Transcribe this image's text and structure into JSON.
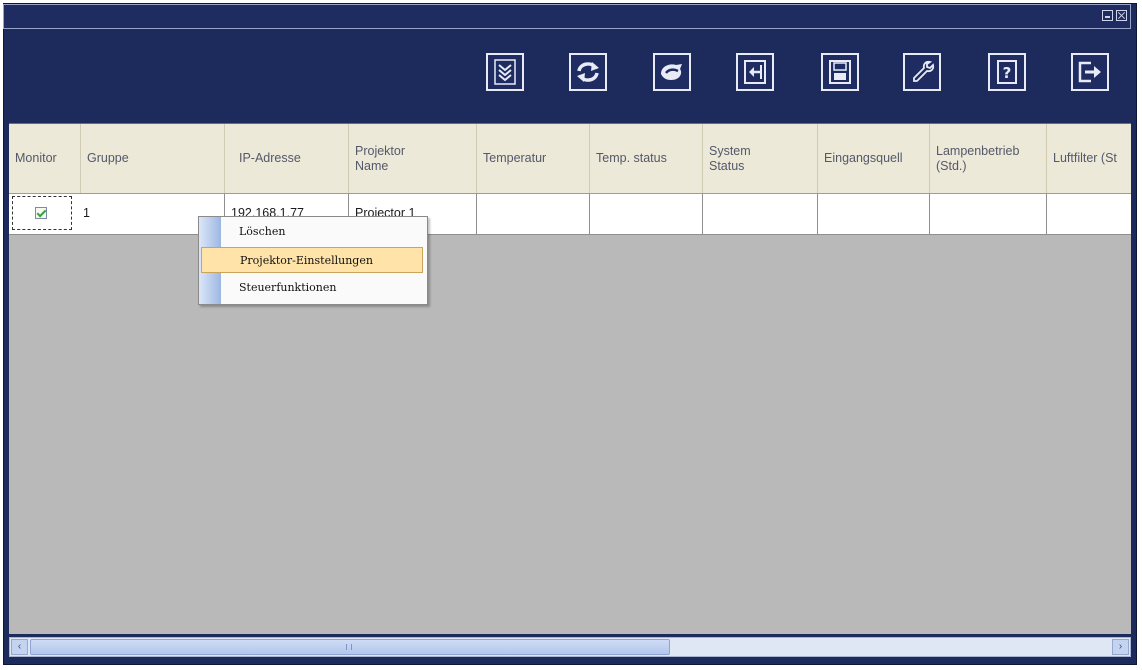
{
  "window": {
    "controls": {
      "minimize_icon": "minimize-icon",
      "close_icon": "close-icon"
    }
  },
  "toolbar": {
    "buttons": [
      {
        "name": "expand-all-button",
        "icon": "double-chevron-down-icon"
      },
      {
        "name": "refresh-button",
        "icon": "refresh-icon"
      },
      {
        "name": "connect-button",
        "icon": "connect-icon"
      },
      {
        "name": "import-button",
        "icon": "import-icon"
      },
      {
        "name": "save-button",
        "icon": "floppy-disk-icon"
      },
      {
        "name": "settings-button",
        "icon": "wrench-icon"
      },
      {
        "name": "help-button",
        "icon": "help-icon"
      },
      {
        "name": "exit-button",
        "icon": "exit-icon"
      }
    ]
  },
  "table": {
    "columns": [
      "Monitor",
      "Gruppe",
      "IP-Adresse",
      "Projektor\nName",
      "Temperatur",
      "Temp. status",
      "System\nStatus",
      "Eingangsquell",
      "Lampenbetrieb\n(Std.)",
      "Luftfilter (St"
    ],
    "rows": [
      {
        "monitor_checked": true,
        "gruppe": "1",
        "ip": "192.168.1.77",
        "name": "Projector 1",
        "temperatur": "",
        "temp_status": "",
        "system_status": "",
        "eingangsquelle": "",
        "lampenbetrieb": "",
        "luftfilter": ""
      }
    ]
  },
  "context_menu": {
    "items": [
      {
        "label": "Löschen",
        "selected": false
      },
      {
        "label": "Projektor-Einstellungen",
        "selected": true
      },
      {
        "label": "Steuerfunktionen",
        "selected": false
      }
    ]
  },
  "scrollbar": {
    "left_arrow": "‹",
    "right_arrow": "›",
    "position": 0
  },
  "colors": {
    "window_bg": "#1c2a5c",
    "header_bg": "#ece9d8",
    "grid_bg": "#b9b9b9",
    "menu_highlight": "#ffe3a8"
  }
}
